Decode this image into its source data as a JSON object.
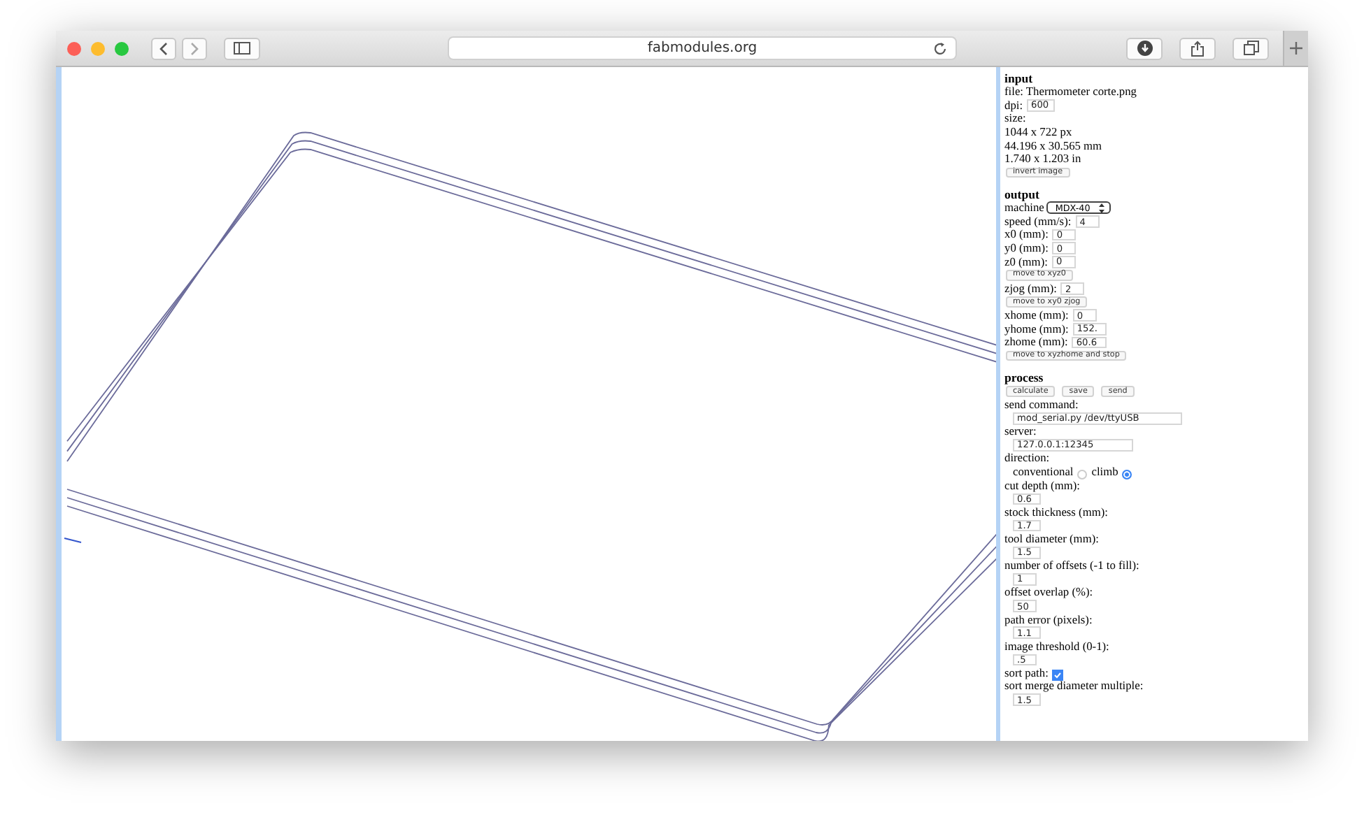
{
  "browser": {
    "url": "fabmodules.org"
  },
  "sections": [
    {
      "title": "input",
      "rows": [
        {
          "kind": "text",
          "label": "file: Thermometer corte.png"
        },
        {
          "kind": "field",
          "label": "dpi:",
          "value": "600"
        },
        {
          "kind": "text",
          "label": "size:"
        },
        {
          "kind": "text",
          "label": "1044 x 722 px"
        },
        {
          "kind": "text",
          "label": "44.196 x 30.565 mm"
        },
        {
          "kind": "text",
          "label": "1.740 x 1.203 in"
        },
        {
          "kind": "button",
          "label": "invert image"
        }
      ]
    },
    {
      "title": "output",
      "rows": [
        {
          "kind": "select",
          "label": "machine",
          "value": "MDX-40"
        },
        {
          "kind": "field",
          "label": "speed (mm/s):",
          "value": "4"
        },
        {
          "kind": "field",
          "label": "x0 (mm):",
          "value": "0"
        },
        {
          "kind": "field",
          "label": "y0 (mm):",
          "value": "0"
        },
        {
          "kind": "field",
          "label": "z0 (mm):",
          "value": "0"
        },
        {
          "kind": "button",
          "label": "move to xyz0"
        },
        {
          "kind": "field",
          "label": "zjog (mm):",
          "value": "2"
        },
        {
          "kind": "button",
          "label": "move to xy0 zjog"
        },
        {
          "kind": "field",
          "label": "xhome (mm):",
          "value": "0"
        },
        {
          "kind": "field",
          "label": "yhome (mm):",
          "value": "152."
        },
        {
          "kind": "field",
          "label": "zhome (mm):",
          "value": "60.6"
        },
        {
          "kind": "button",
          "label": "move to xyzhome and stop"
        }
      ]
    },
    {
      "title": "process",
      "rows": [
        {
          "kind": "buttons",
          "labels": [
            "calculate",
            "save",
            "send"
          ]
        },
        {
          "kind": "wide_field_below",
          "label": "send command:",
          "value": "mod_serial.py /dev/ttyUSB"
        },
        {
          "kind": "wide_field_below",
          "label": "server:",
          "value": "127.0.0.1:12345"
        },
        {
          "kind": "text",
          "label": "direction:"
        },
        {
          "kind": "radio",
          "options": [
            {
              "label": "conventional",
              "selected": false
            },
            {
              "label": "climb",
              "selected": true
            }
          ]
        },
        {
          "kind": "field_below",
          "label": "cut depth (mm):",
          "value": "0.6"
        },
        {
          "kind": "field_below",
          "label": "stock thickness (mm):",
          "value": "1.7"
        },
        {
          "kind": "field_below",
          "label": "tool diameter (mm):",
          "value": "1.5"
        },
        {
          "kind": "field_below",
          "label": "number of offsets (-1 to fill):",
          "value": "1"
        },
        {
          "kind": "field_below",
          "label": "offset overlap (%):",
          "value": "50"
        },
        {
          "kind": "field_below",
          "label": "path error (pixels):",
          "value": "1.1"
        },
        {
          "kind": "field_below",
          "label": "image threshold (0-1):",
          "value": ".5"
        },
        {
          "kind": "checkbox",
          "label": "sort path:",
          "checked": true
        },
        {
          "kind": "field_below",
          "label": "sort merge diameter multiple:",
          "value": "1.5"
        }
      ]
    }
  ]
}
